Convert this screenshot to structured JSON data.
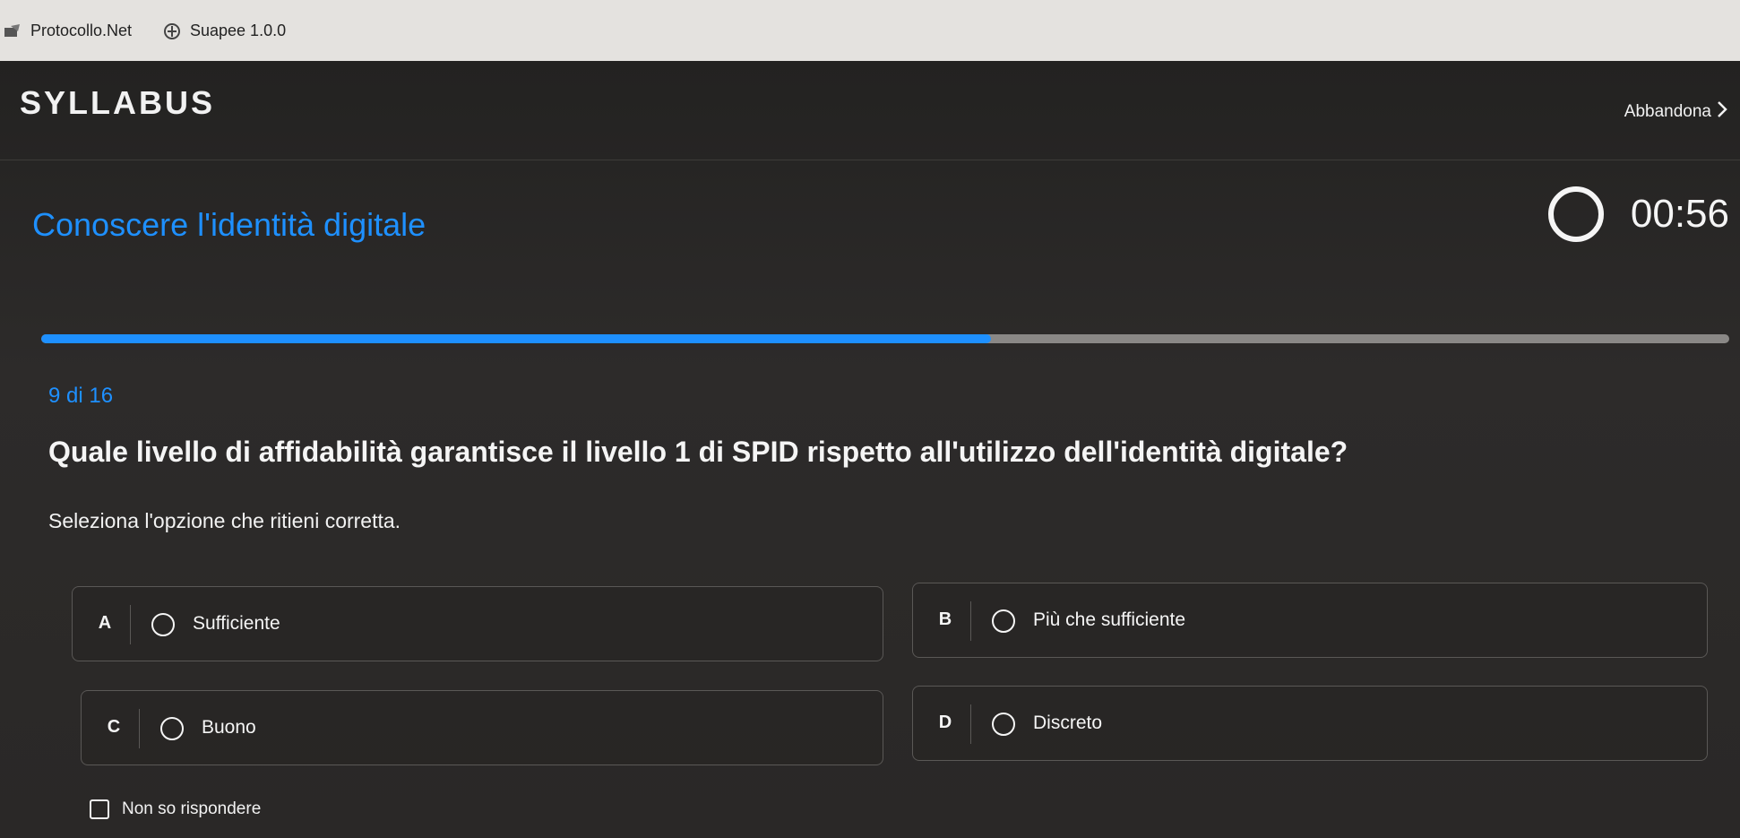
{
  "taskbar": {
    "items": [
      {
        "label": "Protocollo.Net",
        "icon": "protocollo-app-icon"
      },
      {
        "label": "Suapee 1.0.0",
        "icon": "suapee-app-icon"
      }
    ]
  },
  "header": {
    "logo": "SYLLABUS",
    "abbandona_label": "Abbandona",
    "abbandona_icon": "chevron-right-icon"
  },
  "quiz": {
    "course_title": "Conoscere l'identità digitale",
    "timer": "00:56",
    "progress": {
      "current": 9,
      "total": 16
    },
    "counter_text": "9 di 16",
    "question": "Quale livello di affidabilità garantisce il livello 1 di SPID rispetto all'utilizzo dell'identità digitale?",
    "instruction": "Seleziona l'opzione che ritieni corretta.",
    "options": [
      {
        "letter": "A",
        "label": "Sufficiente"
      },
      {
        "letter": "B",
        "label": "Più che sufficiente"
      },
      {
        "letter": "C",
        "label": "Buono"
      },
      {
        "letter": "D",
        "label": "Discreto"
      }
    ],
    "no_answer_label": "Non so rispondere"
  },
  "colors": {
    "accent": "#1e90ff",
    "background": "#2a2827",
    "text": "#f5f5f5",
    "progress_track": "#8a8886"
  }
}
